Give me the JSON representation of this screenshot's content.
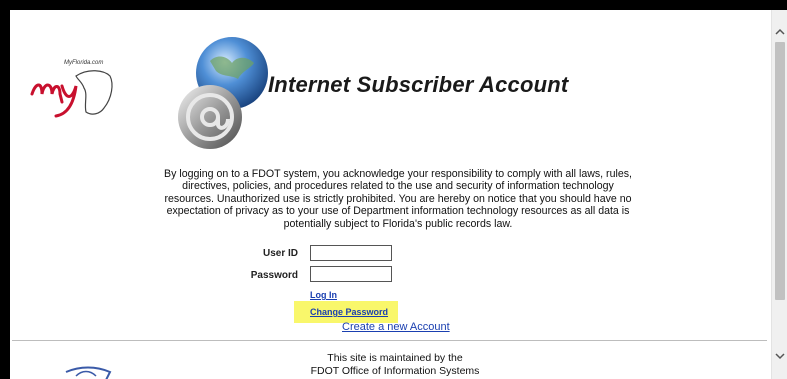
{
  "header": {
    "title": "Internet Subscriber Account",
    "logo_text": "MyFlorida.com"
  },
  "notice": "By logging on to a FDOT system, you acknowledge your responsibility to comply with all laws, rules, directives, policies, and procedures related to the use and security of information technology resources. Unauthorized use is strictly prohibited. You are hereby on notice that you should have no expectation of privacy as to your use of Department information technology resources as all data is potentially subject to Florida's public records law.",
  "login": {
    "user_id_label": "User ID",
    "password_label": "Password",
    "user_id_value": "",
    "password_value": "",
    "login_link": "Log In",
    "change_password_link": "Change Password",
    "create_account_link": "Create a new Account"
  },
  "footer": {
    "line1": "This site is maintained by the",
    "line2": "FDOT Office of Information Systems"
  },
  "colors": {
    "link": "#1a3fb0",
    "highlight": "#f9f76b",
    "logo_red": "#c8102e"
  },
  "icons": {
    "scroll_up": "chevron-up-icon",
    "scroll_down": "chevron-down-icon"
  }
}
